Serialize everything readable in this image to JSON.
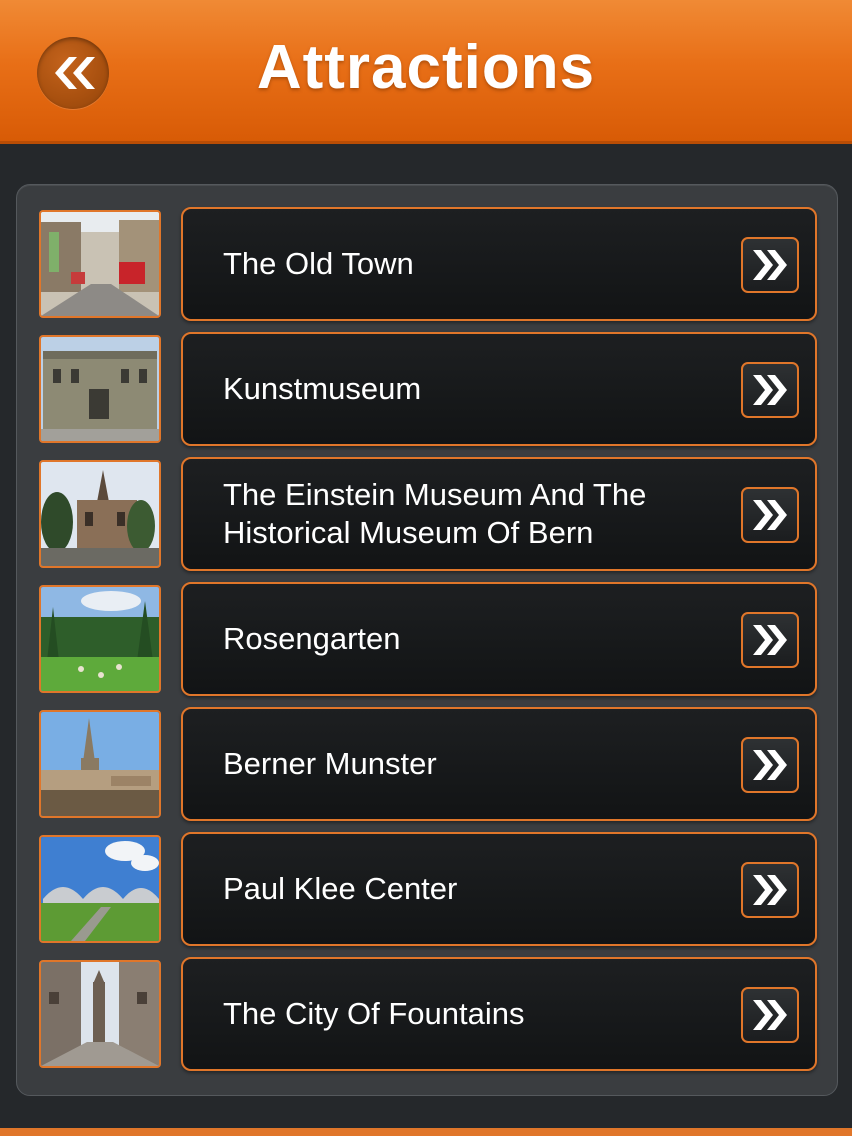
{
  "header": {
    "title": "Attractions",
    "back_icon": "double-chevron-left-icon",
    "accent_color": "#e86f17"
  },
  "attractions": [
    {
      "label": "The Old Town",
      "thumbnail": "old-town-street-photo"
    },
    {
      "label": "Kunstmuseum",
      "thumbnail": "kunstmuseum-building-photo"
    },
    {
      "label": "The Einstein Museum And The Historical Museum Of Bern",
      "thumbnail": "historical-museum-photo"
    },
    {
      "label": "Rosengarten",
      "thumbnail": "rose-garden-park-photo"
    },
    {
      "label": "Berner Munster",
      "thumbnail": "berner-munster-cathedral-photo"
    },
    {
      "label": "Paul Klee Center",
      "thumbnail": "paul-klee-center-photo"
    },
    {
      "label": "The City Of Fountains",
      "thumbnail": "city-fountains-street-photo"
    }
  ],
  "row_action_icon": "double-chevron-right-icon"
}
